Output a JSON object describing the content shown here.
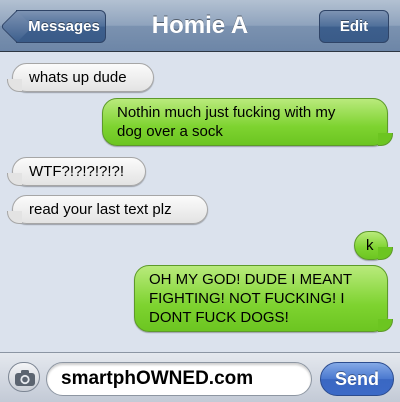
{
  "header": {
    "back_label": "Messages",
    "title": "Homie A",
    "edit_label": "Edit"
  },
  "messages": [
    {
      "direction": "received",
      "text": "whats up dude"
    },
    {
      "direction": "sent",
      "text": "Nothin much just fucking with my dog over a sock"
    },
    {
      "direction": "received",
      "text": "WTF?!?!?!?!?!"
    },
    {
      "direction": "received",
      "text": "read your last text plz"
    },
    {
      "direction": "sent",
      "text": "k"
    },
    {
      "direction": "sent",
      "text": "OH MY GOD! DUDE I MEANT FIGHTING! NOT FUCKING! I DONT FUCK DOGS!"
    }
  ],
  "composer": {
    "input_value": "smartphOWNED.com",
    "send_label": "Send",
    "camera_icon": "camera-icon"
  },
  "colors": {
    "received_bubble": "#e8e8e8",
    "sent_bubble": "#7ed330",
    "navbar": "#7b92b0",
    "send_button": "#3c6ac7"
  }
}
